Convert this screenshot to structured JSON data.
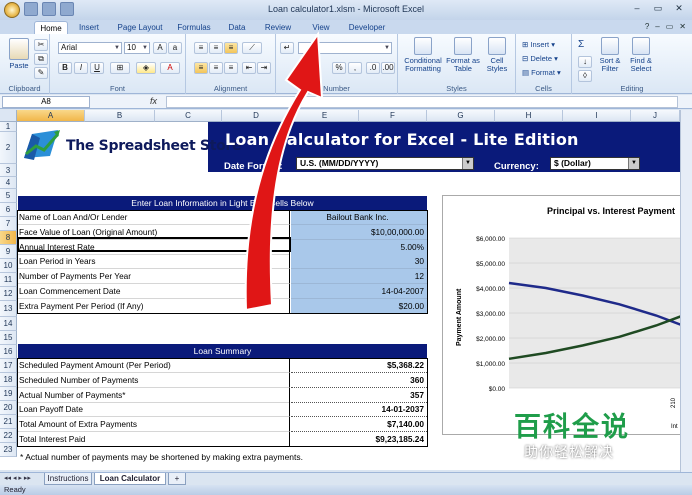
{
  "window": {
    "title": "Loan calculator1.xlsm - Microsoft Excel",
    "min": "–",
    "max": "▭",
    "close": "✕"
  },
  "tabs": [
    "Home",
    "Insert",
    "Page Layout",
    "Formulas",
    "Data",
    "Review",
    "View",
    "Developer"
  ],
  "active_tab": "Home",
  "ribbon": {
    "clipboard": {
      "label": "Clipboard",
      "paste": "Paste"
    },
    "font": {
      "label": "Font",
      "name": "Arial",
      "size": "10",
      "bold": "B",
      "italic": "I",
      "underline": "U"
    },
    "alignment": {
      "label": "Alignment"
    },
    "number": {
      "label": "Number"
    },
    "styles": {
      "label": "Styles",
      "conditional": "Conditional Formatting",
      "format_table": "Format as Table",
      "cell_styles": "Cell Styles"
    },
    "cells": {
      "label": "Cells",
      "insert": "Insert",
      "delete": "Delete",
      "format": "Format"
    },
    "editing": {
      "label": "Editing",
      "sort": "Sort & Filter",
      "find": "Find & Select",
      "sum": "Σ"
    }
  },
  "formula_bar": {
    "name_box": "A8",
    "fx": "fx",
    "content": ""
  },
  "columns": [
    "A",
    "B",
    "C",
    "D",
    "E",
    "F",
    "G",
    "H",
    "I",
    "J"
  ],
  "rows": [
    "1",
    "2",
    "3",
    "4",
    "5",
    "6",
    "7",
    "8",
    "9",
    "10",
    "11",
    "12",
    "13",
    "14",
    "15",
    "16",
    "17",
    "18",
    "19",
    "20",
    "21",
    "22",
    "23"
  ],
  "selected_cell": {
    "col": "A",
    "row": "8"
  },
  "sheet": {
    "brand": "The Spreadsheet Store",
    "title": "Loan Calculator for Excel - Lite Edition",
    "date_format_label": "Date Format:",
    "date_format_value": "U.S. (MM/DD/YYYY)",
    "currency_label": "Currency:",
    "currency_value": "$ (Dollar)",
    "input_header": "Enter Loan Information in Light Blue Cells Below",
    "inputs": [
      {
        "label": "Name of Loan And/Or Lender",
        "value": "Bailout Bank Inc.",
        "align": "center"
      },
      {
        "label": "Face Value of Loan (Original Amount)",
        "value": "$10,00,000.00"
      },
      {
        "label": "Annual Interest Rate",
        "value": "5.00%"
      },
      {
        "label": "Loan Period in Years",
        "value": "30"
      },
      {
        "label": "Number of Payments Per Year",
        "value": "12"
      },
      {
        "label": "Loan Commencement Date",
        "value": "14-04-2007"
      },
      {
        "label": "Extra Payment Per Period (If Any)",
        "value": "$20.00"
      }
    ],
    "summary_header": "Loan Summary",
    "summary": [
      {
        "label": "Scheduled Payment Amount (Per Period)",
        "value": "$5,368.22"
      },
      {
        "label": "Scheduled Number of Payments",
        "value": "360"
      },
      {
        "label": "Actual Number of Payments*",
        "value": "357"
      },
      {
        "label": "Loan Payoff Date",
        "value": "14-01-2037"
      },
      {
        "label": "Total Amount of Extra Payments",
        "value": "$7,140.00"
      },
      {
        "label": "Total Interest Paid",
        "value": "$9,23,185.24"
      }
    ],
    "footnote": "* Actual number of payments may be shortened by making extra payments."
  },
  "chart_data": {
    "type": "line",
    "title": "Principal vs. Interest Payment",
    "ylabel": "Payment Amount",
    "ylim": [
      0,
      6000
    ],
    "yticks": [
      "$6,000.00",
      "$5,000.00",
      "$4,000.00",
      "$3,000.00",
      "$2,000.00",
      "$1,000.00",
      "$0.00"
    ],
    "x_partial_label": "210",
    "legend_partial": "Int",
    "series": [
      {
        "color": "#1f2a8a",
        "values": [
          4200,
          4000,
          3700,
          3350,
          2900,
          2350
        ]
      },
      {
        "color": "#1f4a22",
        "values": [
          1170,
          1400,
          1700,
          2050,
          2500,
          3050
        ]
      }
    ]
  },
  "sheet_tabs": [
    "Instructions",
    "Loan Calculator"
  ],
  "active_sheet": "Loan Calculator",
  "status": "Ready",
  "watermark": {
    "main": "百科全说",
    "sub": "助你轻松解决"
  },
  "colors": {
    "navy": "#0a1a7a",
    "input_blue": "#a9c8ea",
    "arrow_red": "#e01616",
    "watermark_green": "#1f9d4a"
  }
}
